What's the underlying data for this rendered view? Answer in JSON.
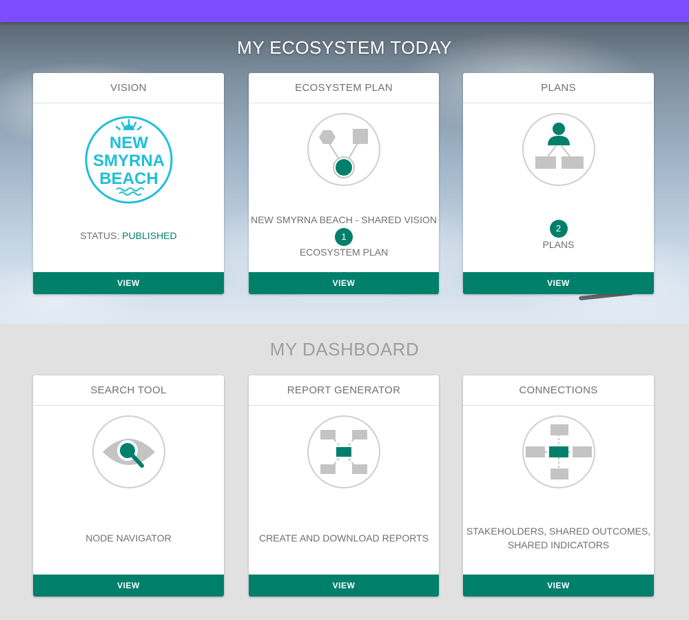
{
  "colors": {
    "topbar": "#7c4dff",
    "accent": "#00806b",
    "logo": "#1fbfd6"
  },
  "ecosystem": {
    "title": "MY ECOSYSTEM TODAY",
    "cards": {
      "vision": {
        "title": "VISION",
        "logo_lines": [
          "NEW",
          "SMYRNA",
          "BEACH"
        ],
        "status_label": "STATUS:",
        "status_value": "PUBLISHED",
        "button": "VIEW"
      },
      "ecosystem_plan": {
        "title": "ECOSYSTEM PLAN",
        "icon": "network-nodes-icon",
        "subtitle": "NEW SMYRNA BEACH - SHARED VISION",
        "count": "1",
        "count_label": "ECOSYSTEM PLAN",
        "button": "VIEW"
      },
      "plans": {
        "title": "PLANS",
        "icon": "org-chart-icon",
        "count": "2",
        "count_label": "PLANS",
        "button": "VIEW"
      }
    }
  },
  "dashboard": {
    "title": "MY DASHBOARD",
    "cards": {
      "search_tool": {
        "title": "SEARCH TOOL",
        "icon": "eye-search-icon",
        "description": "NODE NAVIGATOR",
        "button": "VIEW"
      },
      "report_generator": {
        "title": "REPORT GENERATOR",
        "icon": "report-nodes-icon",
        "description": "CREATE AND DOWNLOAD REPORTS",
        "button": "VIEW"
      },
      "connections": {
        "title": "CONNECTIONS",
        "icon": "connections-icon",
        "description_line1": "STAKEHOLDERS, SHARED OUTCOMES,",
        "description_line2": "SHARED INDICATORS",
        "button": "VIEW"
      }
    }
  }
}
